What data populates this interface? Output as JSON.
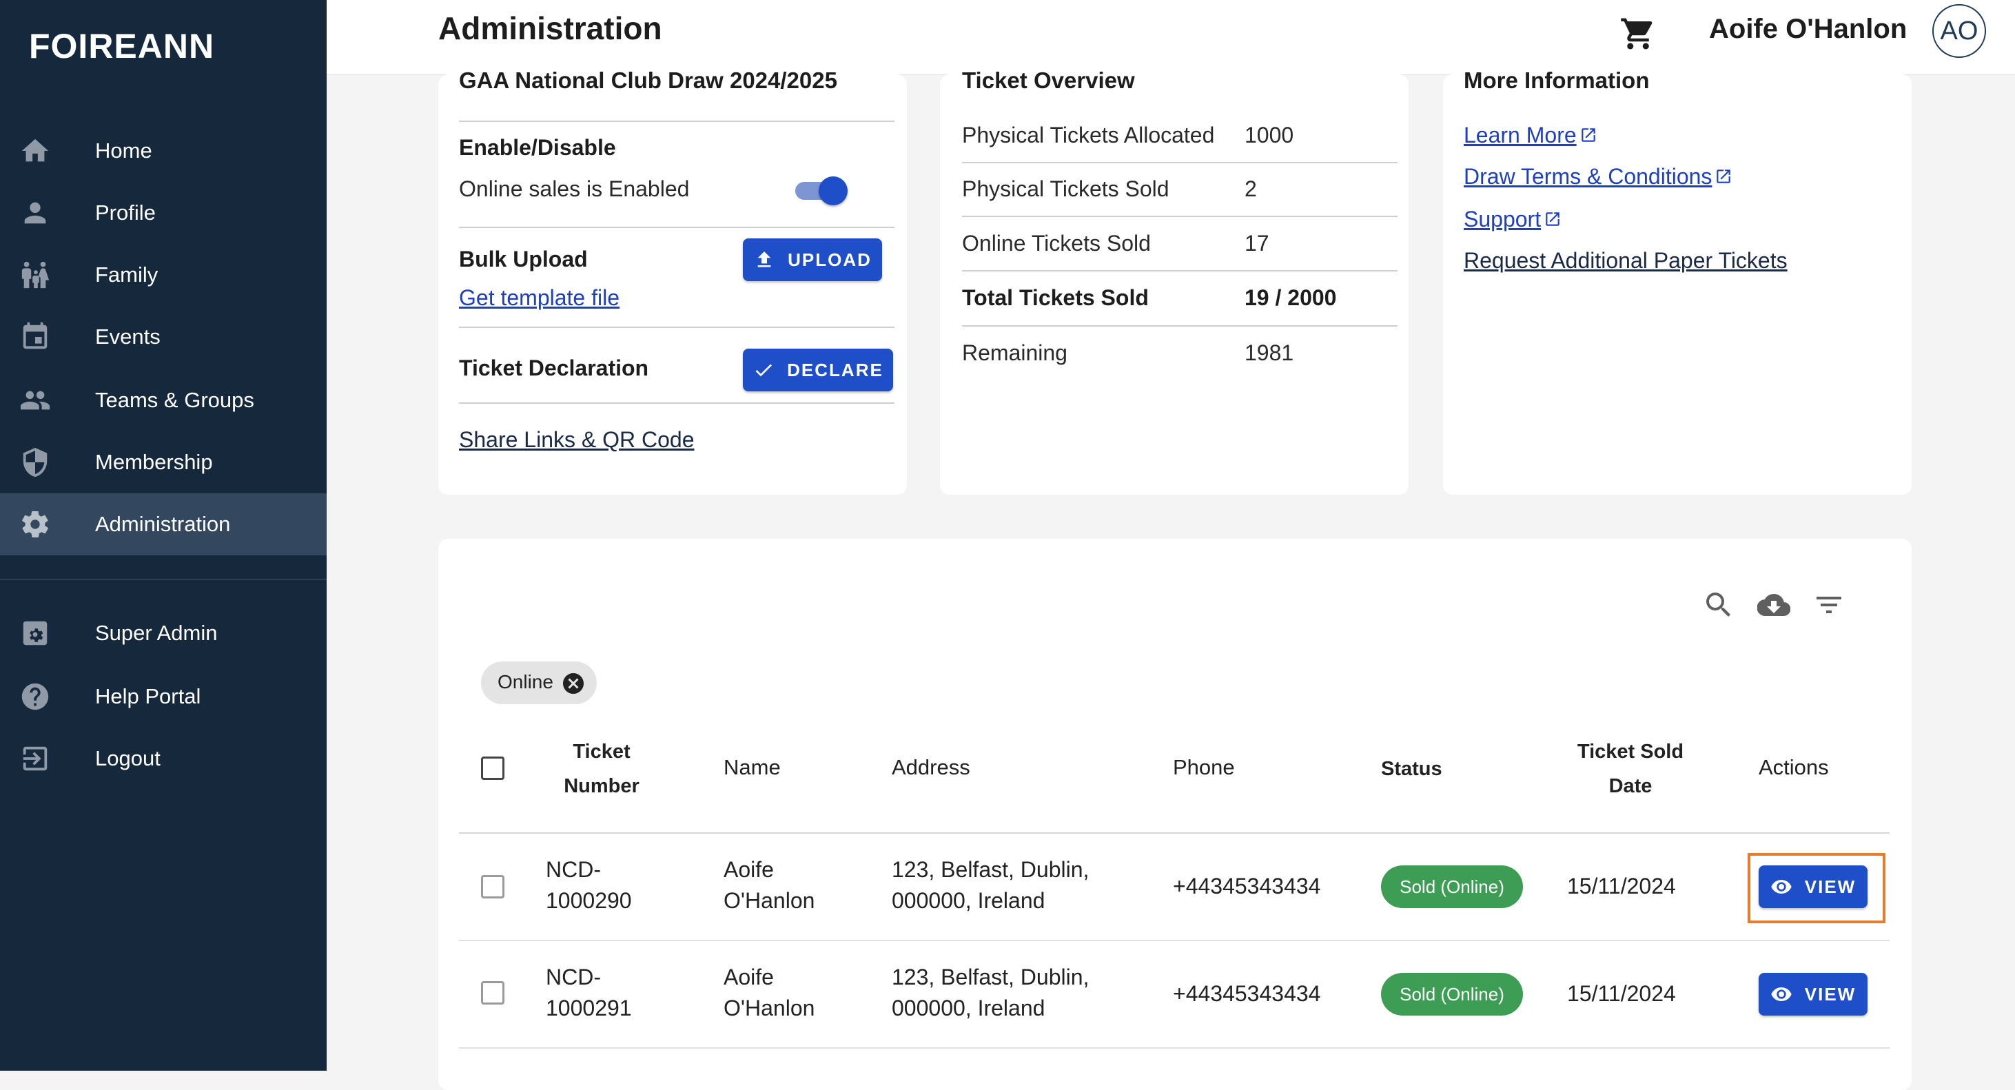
{
  "app": {
    "brand": "FOIREANN"
  },
  "sidebar": {
    "items": [
      {
        "label": "Home",
        "icon": "home-icon"
      },
      {
        "label": "Profile",
        "icon": "person-icon"
      },
      {
        "label": "Family",
        "icon": "family-icon"
      },
      {
        "label": "Events",
        "icon": "calendar-icon"
      },
      {
        "label": "Teams & Groups",
        "icon": "group-icon"
      },
      {
        "label": "Membership",
        "icon": "shield-icon"
      },
      {
        "label": "Administration",
        "icon": "gear-icon",
        "active": true
      },
      {
        "label": "Super Admin",
        "icon": "admin-icon"
      },
      {
        "label": "Help Portal",
        "icon": "help-icon"
      },
      {
        "label": "Logout",
        "icon": "logout-icon"
      }
    ]
  },
  "header": {
    "title": "Administration",
    "user_name": "Aoife O'Hanlon",
    "avatar_initials": "AO"
  },
  "draw_card": {
    "title": "GAA National Club Draw 2024/2025",
    "enable_heading": "Enable/Disable",
    "online_status": "Online sales is Enabled",
    "bulk_heading": "Bulk Upload",
    "upload_label": "UPLOAD",
    "template_link": "Get template file",
    "declaration_heading": "Ticket Declaration",
    "declare_label": "DECLARE",
    "share_link": "Share Links & QR Code"
  },
  "overview_card": {
    "title": "Ticket Overview",
    "rows": [
      {
        "label": "Physical Tickets Allocated",
        "value": "1000"
      },
      {
        "label": "Physical Tickets Sold",
        "value": "2"
      },
      {
        "label": "Online Tickets Sold",
        "value": "17"
      },
      {
        "label": "Total Tickets Sold",
        "value": "19 / 2000"
      },
      {
        "label": "Remaining",
        "value": "1981"
      }
    ]
  },
  "info_card": {
    "title": "More Information",
    "links": [
      "Learn More",
      "Draw Terms & Conditions",
      "Support",
      "Request Additional Paper Tickets"
    ]
  },
  "table": {
    "filter_chip": "Online",
    "columns": {
      "ticket_number_1": "Ticket",
      "ticket_number_2": "Number",
      "name": "Name",
      "address": "Address",
      "phone": "Phone",
      "status": "Status",
      "sold_date_1": "Ticket Sold",
      "sold_date_2": "Date",
      "actions": "Actions"
    },
    "rows": [
      {
        "ticket_1": "NCD-",
        "ticket_2": "1000290",
        "name_1": "Aoife",
        "name_2": "O'Hanlon",
        "address_1": "123, Belfast, Dublin,",
        "address_2": "000000, Ireland",
        "phone": "+44345343434",
        "status": "Sold (Online)",
        "date": "15/11/2024",
        "action": "VIEW"
      },
      {
        "ticket_1": "NCD-",
        "ticket_2": "1000291",
        "name_1": "Aoife",
        "name_2": "O'Hanlon",
        "address_1": "123, Belfast, Dublin,",
        "address_2": "000000, Ireland",
        "phone": "+44345343434",
        "status": "Sold (Online)",
        "date": "15/11/2024",
        "action": "VIEW"
      }
    ]
  },
  "colors": {
    "sidebar_bg": "#16283b",
    "sidebar_active": "#33485e",
    "primary_button": "#1e4fc8",
    "status_sold": "#3e9d55",
    "highlight_outline": "#e87b2e"
  }
}
